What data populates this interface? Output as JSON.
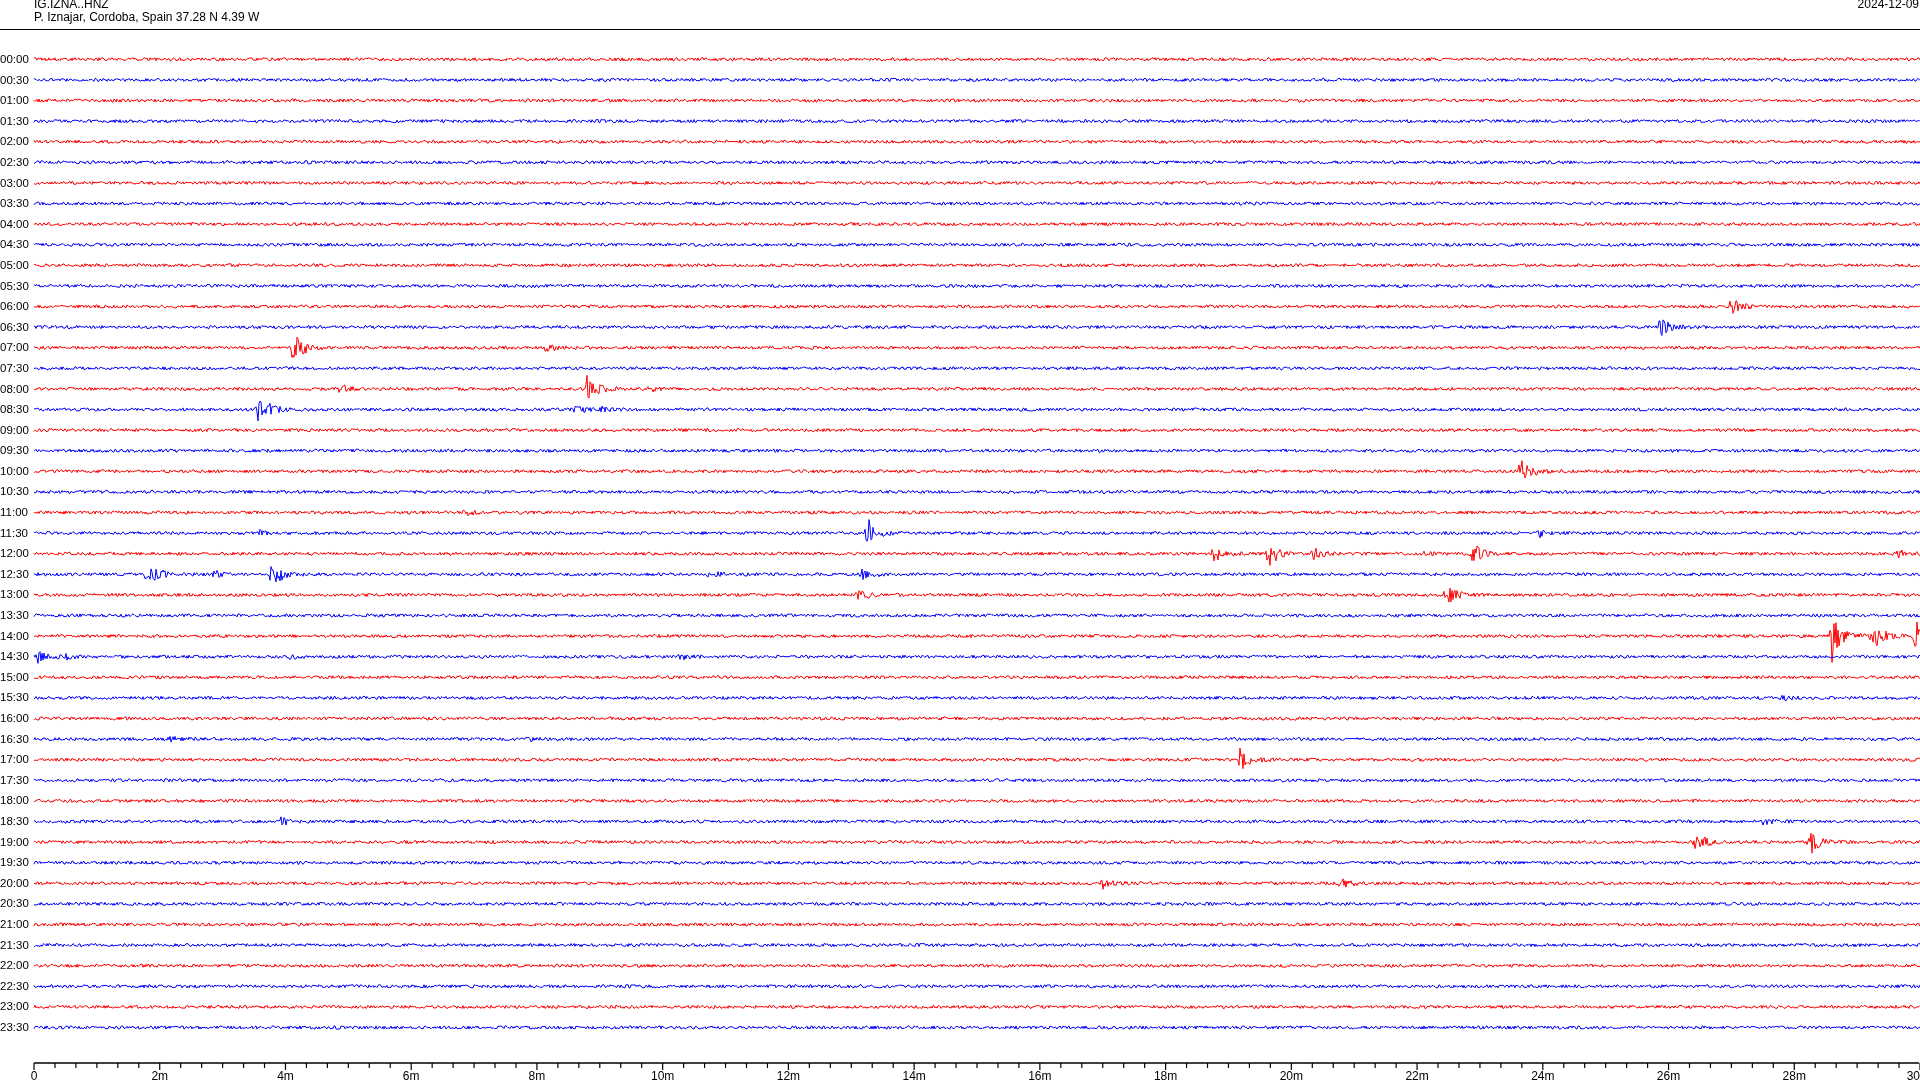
{
  "header": {
    "station": "IG.IZNA..HNZ",
    "location": "P. Iznajar, Cordoba, Spain  37.28 N 4.39 W",
    "date": "2024-12-09"
  },
  "rows": [
    {
      "label": "00:00",
      "color": "#ff0000"
    },
    {
      "label": "00:30",
      "color": "#0000ff"
    },
    {
      "label": "01:00",
      "color": "#ff0000"
    },
    {
      "label": "01:30",
      "color": "#0000ff"
    },
    {
      "label": "02:00",
      "color": "#ff0000"
    },
    {
      "label": "02:30",
      "color": "#0000ff"
    },
    {
      "label": "03:00",
      "color": "#ff0000"
    },
    {
      "label": "03:30",
      "color": "#0000ff"
    },
    {
      "label": "04:00",
      "color": "#ff0000"
    },
    {
      "label": "04:30",
      "color": "#0000ff"
    },
    {
      "label": "05:00",
      "color": "#ff0000"
    },
    {
      "label": "05:30",
      "color": "#0000ff"
    },
    {
      "label": "06:00",
      "color": "#ff0000"
    },
    {
      "label": "06:30",
      "color": "#0000ff"
    },
    {
      "label": "07:00",
      "color": "#ff0000"
    },
    {
      "label": "07:30",
      "color": "#0000ff"
    },
    {
      "label": "08:00",
      "color": "#ff0000"
    },
    {
      "label": "08:30",
      "color": "#0000ff"
    },
    {
      "label": "09:00",
      "color": "#ff0000"
    },
    {
      "label": "09:30",
      "color": "#0000ff"
    },
    {
      "label": "10:00",
      "color": "#ff0000"
    },
    {
      "label": "10:30",
      "color": "#0000ff"
    },
    {
      "label": "11:00",
      "color": "#ff0000"
    },
    {
      "label": "11:30",
      "color": "#0000ff"
    },
    {
      "label": "12:00",
      "color": "#ff0000"
    },
    {
      "label": "12:30",
      "color": "#0000ff"
    },
    {
      "label": "13:00",
      "color": "#ff0000"
    },
    {
      "label": "13:30",
      "color": "#0000ff"
    },
    {
      "label": "14:00",
      "color": "#ff0000"
    },
    {
      "label": "14:30",
      "color": "#0000ff"
    },
    {
      "label": "15:00",
      "color": "#ff0000"
    },
    {
      "label": "15:30",
      "color": "#0000ff"
    },
    {
      "label": "16:00",
      "color": "#ff0000"
    },
    {
      "label": "16:30",
      "color": "#0000ff"
    },
    {
      "label": "17:00",
      "color": "#ff0000"
    },
    {
      "label": "17:30",
      "color": "#0000ff"
    },
    {
      "label": "18:00",
      "color": "#ff0000"
    },
    {
      "label": "18:30",
      "color": "#0000ff"
    },
    {
      "label": "19:00",
      "color": "#ff0000"
    },
    {
      "label": "19:30",
      "color": "#0000ff"
    },
    {
      "label": "20:00",
      "color": "#ff0000"
    },
    {
      "label": "20:30",
      "color": "#0000ff"
    },
    {
      "label": "21:00",
      "color": "#ff0000"
    },
    {
      "label": "21:30",
      "color": "#0000ff"
    },
    {
      "label": "22:00",
      "color": "#ff0000"
    },
    {
      "label": "22:30",
      "color": "#0000ff"
    },
    {
      "label": "23:00",
      "color": "#ff0000"
    },
    {
      "label": "23:30",
      "color": "#0000ff"
    }
  ],
  "x_axis": {
    "ticks": [
      "0",
      "2m",
      "4m",
      "6m",
      "8m",
      "10m",
      "12m",
      "14m",
      "16m",
      "18m",
      "20m",
      "22m",
      "24m",
      "26m",
      "28m",
      "30"
    ]
  }
}
